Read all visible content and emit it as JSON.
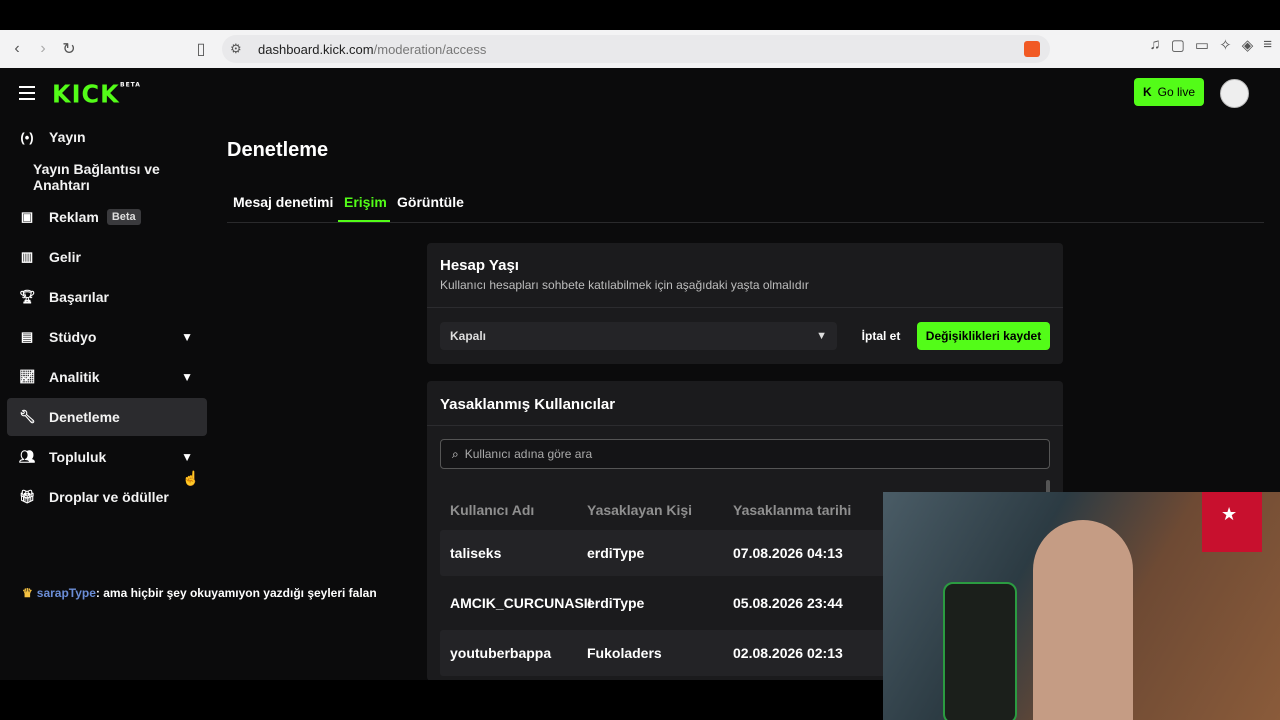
{
  "browser": {
    "url_host": "dashboard.kick.com",
    "url_path": "/moderation/access",
    "brave_count": "5"
  },
  "header": {
    "logo_text": "KICK",
    "logo_tag": "BETA",
    "go_live_label": "Go live"
  },
  "sidebar": {
    "items": [
      {
        "label": "Yayın",
        "icon": "broadcast-icon"
      },
      {
        "label": "Yayın Bağlantısı ve Anahtarı",
        "icon": ""
      },
      {
        "label": "Reklam",
        "icon": "ad-icon",
        "badge": "Beta"
      },
      {
        "label": "Gelir",
        "icon": "revenue-icon"
      },
      {
        "label": "Başarılar",
        "icon": "trophy-icon"
      },
      {
        "label": "Stüdyo",
        "icon": "studio-icon"
      },
      {
        "label": "Analitik",
        "icon": "analytics-icon"
      },
      {
        "label": "Denetleme",
        "icon": "wrench-icon"
      },
      {
        "label": "Topluluk",
        "icon": "community-icon"
      },
      {
        "label": "Droplar ve ödüller",
        "icon": "gift-icon"
      }
    ]
  },
  "chat": {
    "username": "sarapType",
    "message": ": ama hiçbir şey okuyamıyon yazdığı şeyleri falan"
  },
  "main": {
    "title": "Denetleme",
    "tabs": [
      "Mesaj denetimi",
      "Erişim",
      "Görüntüle"
    ],
    "active_tab": "Erişim"
  },
  "account_age": {
    "title": "Hesap Yaşı",
    "subtitle": "Kullanıcı hesapları sohbete katılabilmek için aşağıdaki yaşta olmalıdır",
    "select_value": "Kapalı",
    "cancel_label": "İptal et",
    "save_label": "Değişiklikleri kaydet"
  },
  "banned": {
    "title": "Yasaklanmış Kullanıcılar",
    "search_placeholder": "Kullanıcı adına göre ara",
    "columns": [
      "Kullanıcı Adı",
      "Yasaklayan Kişi",
      "Yasaklanma tarihi"
    ],
    "rows": [
      {
        "user": "taliseks",
        "by": "erdiType",
        "date": "07.08.2026 04:13"
      },
      {
        "user": "AMCIK_CURCUNASII",
        "by": "erdiType",
        "date": "05.08.2026 23:44"
      },
      {
        "user": "youtuberbappa",
        "by": "Fukoladers",
        "date": "02.08.2026 02:13"
      }
    ]
  },
  "colors": {
    "accent": "#53fc18",
    "background": "#0b0b0c",
    "card": "#1b1b1d"
  }
}
